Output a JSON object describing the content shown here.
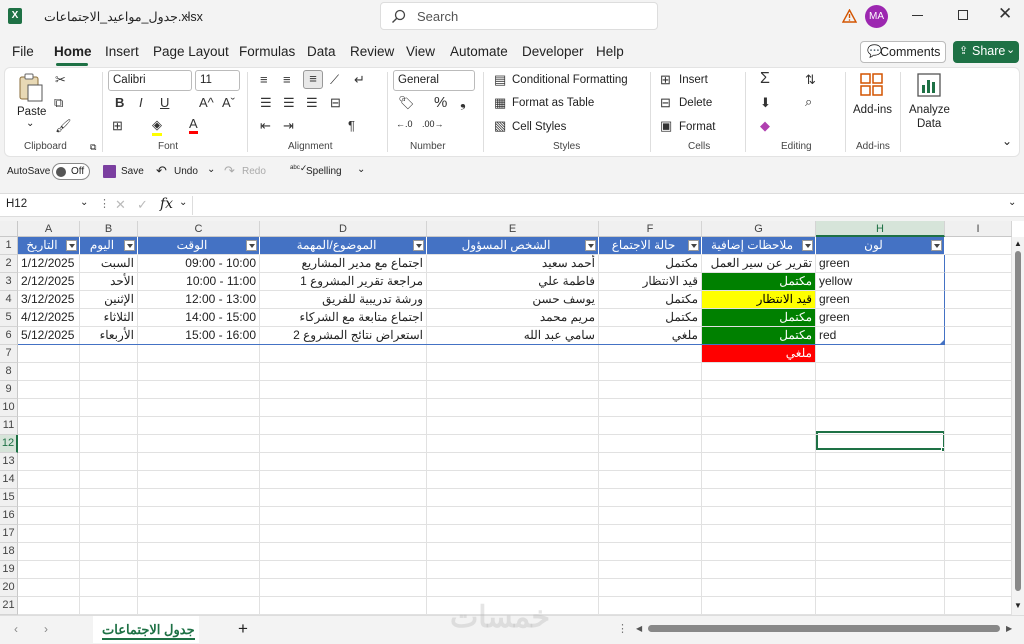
{
  "title_bar": {
    "file_name": "جدول_مواعيد_الاجتماعات.xlsx",
    "search_placeholder": "Search",
    "avatar_initials": "MA"
  },
  "menu": [
    "File",
    "Home",
    "Insert",
    "Page Layout",
    "Formulas",
    "Data",
    "Review",
    "View",
    "Automate",
    "Developer",
    "Help"
  ],
  "menu_active": "Home",
  "comments_label": "Comments",
  "share_label": "Share",
  "ribbon": {
    "clipboard": {
      "paste": "Paste",
      "group": "Clipboard"
    },
    "font": {
      "family": "Calibri",
      "size": "11",
      "group": "Font"
    },
    "alignment": {
      "group": "Alignment"
    },
    "number": {
      "format": "General",
      "group": "Number"
    },
    "styles": {
      "conditional": "Conditional Formatting",
      "format_table": "Format as Table",
      "cell_styles": "Cell Styles",
      "group": "Styles"
    },
    "cells": {
      "insert": "Insert",
      "delete": "Delete",
      "format": "Format",
      "group": "Cells"
    },
    "editing": {
      "group": "Editing"
    },
    "addins": {
      "label": "Add-ins",
      "group": "Add-ins"
    },
    "analyze": {
      "label1": "Analyze",
      "label2": "Data"
    }
  },
  "qat": {
    "autosave": "AutoSave",
    "off": "Off",
    "save": "Save",
    "undo": "Undo",
    "redo": "Redo",
    "spelling": "Spelling"
  },
  "formula_bar": {
    "name_box": "H12",
    "formula": ""
  },
  "columns": [
    "A",
    "B",
    "C",
    "D",
    "E",
    "F",
    "G",
    "H",
    "I"
  ],
  "table_headers": [
    "التاريخ",
    "اليوم",
    "الوقت",
    "الموضوع/المهمة",
    "الشخص المسؤول",
    "حالة الاجتماع",
    "ملاحظات إضافية",
    "لون"
  ],
  "rows": [
    [
      "1/12/2025",
      "السبت",
      "09:00 - 10:00",
      "اجتماع مع مدير المشاريع",
      "أحمد سعيد",
      "مكتمل",
      "تقرير عن سير العمل",
      "green"
    ],
    [
      "2/12/2025",
      "الأحد",
      "10:00 - 11:00",
      "مراجعة تقرير المشروع 1",
      "فاطمة علي",
      "قيد الانتظار",
      "مكتمل",
      "yellow"
    ],
    [
      "3/12/2025",
      "الإثنين",
      "12:00 - 13:00",
      "ورشة تدريبية للفريق",
      "يوسف حسن",
      "مكتمل",
      "قيد الانتظار",
      "green"
    ],
    [
      "4/12/2025",
      "الثلاثاء",
      "14:00 - 15:00",
      "اجتماع متابعة مع الشركاء",
      "مريم محمد",
      "مكتمل",
      "مكتمل",
      "green"
    ],
    [
      "5/12/2025",
      "الأربعاء",
      "15:00 - 16:00",
      "استعراض نتائج المشروع 2",
      "سامي عبد الله",
      "ملغي",
      "مكتمل",
      "red"
    ]
  ],
  "extra_g7": "ملغي",
  "row_numbers": [
    "1",
    "2",
    "3",
    "4",
    "5",
    "6",
    "7",
    "8",
    "9",
    "10",
    "11",
    "12",
    "13",
    "14",
    "15",
    "16",
    "17",
    "18",
    "19",
    "20",
    "21"
  ],
  "colors": {
    "header_blue": "#4472c4",
    "green": "#008000",
    "yellow": "#ffff00",
    "red": "#ff0000",
    "excel_green": "#1e7145"
  },
  "sheet_tab": "جدول الاجتماعات",
  "watermark": "خمسات"
}
